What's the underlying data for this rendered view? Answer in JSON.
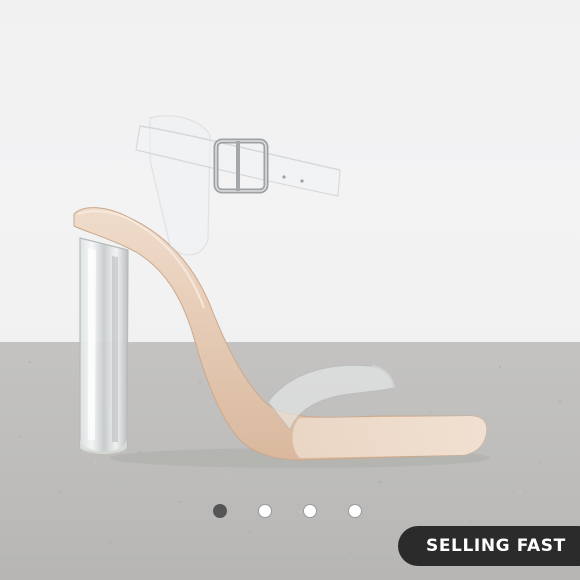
{
  "carousel": {
    "slide_count": 4,
    "active_index": 0,
    "dots": [
      {
        "state": "active"
      },
      {
        "state": "inactive"
      },
      {
        "state": "inactive"
      },
      {
        "state": "inactive"
      }
    ]
  },
  "badge": {
    "label": "SELLING FAST",
    "background": "#2b2b2b",
    "text_color": "#ffffff"
  },
  "image": {
    "subject_icon": "clear-block-heel-sandal-icon"
  },
  "colors": {
    "wall": "#f1f1f2",
    "floor": "#c0bfbd",
    "insole": "#e8cdb6",
    "dot_active": "#555555"
  }
}
